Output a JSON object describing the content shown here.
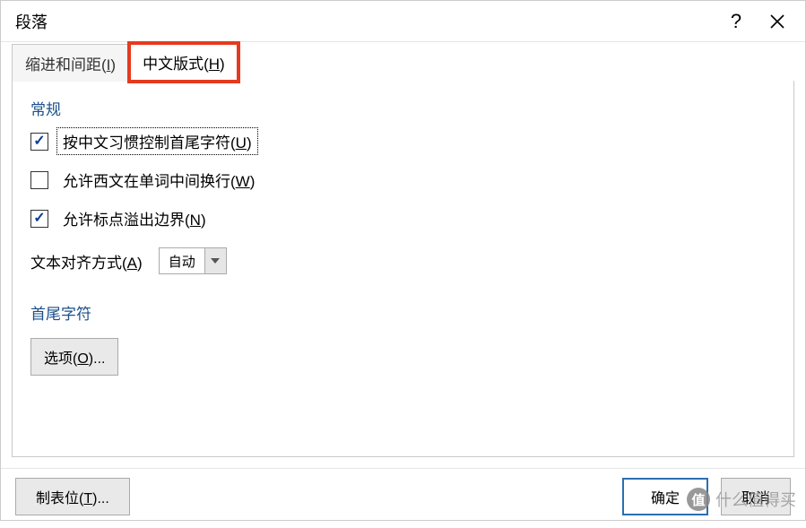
{
  "title": "段落",
  "tabs": {
    "indent": {
      "label": "缩进和间距",
      "mn": "I"
    },
    "asian": {
      "label": "中文版式",
      "mn": "H"
    }
  },
  "group_general": "常规",
  "opts": {
    "ctrl_chars": {
      "label": "按中文习惯控制首尾字符",
      "mn": "U",
      "checked": true,
      "focused": true
    },
    "latin_wrap": {
      "label": "允许西文在单词中间换行",
      "mn": "W",
      "checked": false,
      "focused": false
    },
    "punct_overflow": {
      "label": "允许标点溢出边界",
      "mn": "N",
      "checked": true,
      "focused": false
    }
  },
  "align": {
    "label": "文本对齐方式",
    "mn": "A",
    "value": "自动"
  },
  "group_chars": "首尾字符",
  "options_btn": {
    "label": "选项",
    "mn": "O",
    "suffix": "..."
  },
  "footer": {
    "tabs_btn": {
      "label": "制表位",
      "mn": "T",
      "suffix": "..."
    },
    "ok": "确定",
    "cancel": "取消"
  },
  "watermark": "什么值得买"
}
